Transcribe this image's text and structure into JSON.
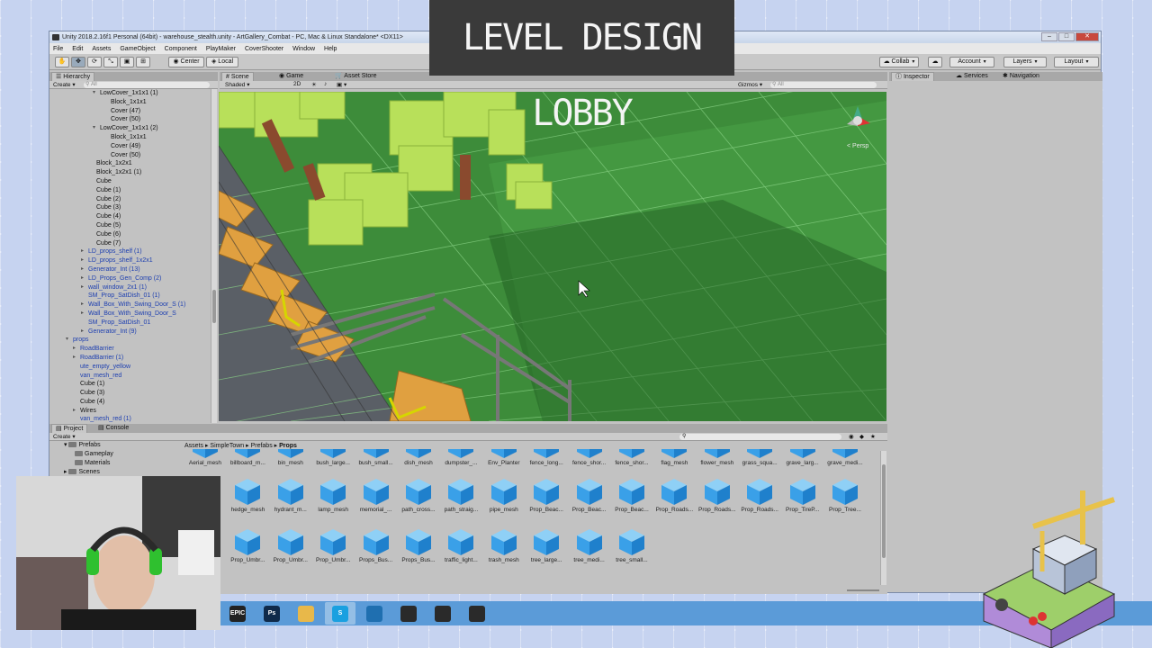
{
  "window": {
    "title": "Unity 2018.2.16f1 Personal (64bit) - warehouse_stealth.unity - ArtGallery_Combat - PC, Mac & Linux Standalone* <DX11>",
    "controls": {
      "minimize": "–",
      "maximize": "□",
      "close": "✕"
    }
  },
  "menu": [
    "File",
    "Edit",
    "Assets",
    "GameObject",
    "Component",
    "PlayMaker",
    "CoverShooter",
    "Window",
    "Help"
  ],
  "toolbar": {
    "pivot_center": "Center",
    "pivot_local": "Local",
    "collab": "Collab",
    "account": "Account",
    "layers": "Layers",
    "layout": "Layout"
  },
  "banner": {
    "text": "LEVEL DESIGN LOBBY"
  },
  "hierarchy": {
    "tab": "Hierarchy",
    "create": "Create",
    "search_placeholder": "All",
    "items": [
      {
        "label": "LowCover_1x1x1 (1)",
        "indent": 56,
        "prefab": false,
        "arrow": "▾"
      },
      {
        "label": "Block_1x1x1",
        "indent": 68,
        "prefab": false,
        "arrow": ""
      },
      {
        "label": "Cover (47)",
        "indent": 68,
        "prefab": false,
        "arrow": ""
      },
      {
        "label": "Cover (50)",
        "indent": 68,
        "prefab": false,
        "arrow": ""
      },
      {
        "label": "LowCover_1x1x1 (2)",
        "indent": 56,
        "prefab": false,
        "arrow": "▾"
      },
      {
        "label": "Block_1x1x1",
        "indent": 68,
        "prefab": false,
        "arrow": ""
      },
      {
        "label": "Cover (49)",
        "indent": 68,
        "prefab": false,
        "arrow": ""
      },
      {
        "label": "Cover (50)",
        "indent": 68,
        "prefab": false,
        "arrow": ""
      },
      {
        "label": "Block_1x2x1",
        "indent": 52,
        "prefab": false,
        "arrow": ""
      },
      {
        "label": "Block_1x2x1 (1)",
        "indent": 52,
        "prefab": false,
        "arrow": ""
      },
      {
        "label": "Cube",
        "indent": 52,
        "prefab": false,
        "arrow": ""
      },
      {
        "label": "Cube (1)",
        "indent": 52,
        "prefab": false,
        "arrow": ""
      },
      {
        "label": "Cube (2)",
        "indent": 52,
        "prefab": false,
        "arrow": ""
      },
      {
        "label": "Cube (3)",
        "indent": 52,
        "prefab": false,
        "arrow": ""
      },
      {
        "label": "Cube (4)",
        "indent": 52,
        "prefab": false,
        "arrow": ""
      },
      {
        "label": "Cube (5)",
        "indent": 52,
        "prefab": false,
        "arrow": ""
      },
      {
        "label": "Cube (6)",
        "indent": 52,
        "prefab": false,
        "arrow": ""
      },
      {
        "label": "Cube (7)",
        "indent": 52,
        "prefab": false,
        "arrow": ""
      },
      {
        "label": "LD_props_shelf (1)",
        "indent": 43,
        "prefab": true,
        "arrow": "▸"
      },
      {
        "label": "LD_props_shelf_1x2x1",
        "indent": 43,
        "prefab": true,
        "arrow": "▸"
      },
      {
        "label": "Generator_Int (13)",
        "indent": 43,
        "prefab": true,
        "arrow": "▸"
      },
      {
        "label": "LD_Props_Gen_Comp (2)",
        "indent": 43,
        "prefab": true,
        "arrow": "▸"
      },
      {
        "label": "wall_window_2x1 (1)",
        "indent": 43,
        "prefab": true,
        "arrow": "▸"
      },
      {
        "label": "SM_Prop_SatDish_01 (1)",
        "indent": 43,
        "prefab": true,
        "arrow": ""
      },
      {
        "label": "Wall_Box_With_Swing_Door_S (1)",
        "indent": 43,
        "prefab": true,
        "arrow": "▸"
      },
      {
        "label": "Wall_Box_With_Swing_Door_S",
        "indent": 43,
        "prefab": true,
        "arrow": "▸"
      },
      {
        "label": "SM_Prop_SatDish_01",
        "indent": 43,
        "prefab": true,
        "arrow": ""
      },
      {
        "label": "Generator_Int (9)",
        "indent": 43,
        "prefab": true,
        "arrow": "▸"
      },
      {
        "label": "props",
        "indent": 26,
        "prefab": true,
        "arrow": "▾"
      },
      {
        "label": "RoadBarrier",
        "indent": 34,
        "prefab": true,
        "arrow": "▸"
      },
      {
        "label": "RoadBarrier (1)",
        "indent": 34,
        "prefab": true,
        "arrow": "▸"
      },
      {
        "label": "ute_empty_yellow",
        "indent": 34,
        "prefab": true,
        "arrow": ""
      },
      {
        "label": "van_mesh_red",
        "indent": 34,
        "prefab": true,
        "arrow": ""
      },
      {
        "label": "Cube (1)",
        "indent": 34,
        "prefab": false,
        "arrow": ""
      },
      {
        "label": "Cube (3)",
        "indent": 34,
        "prefab": false,
        "arrow": ""
      },
      {
        "label": "Cube (4)",
        "indent": 34,
        "prefab": false,
        "arrow": ""
      },
      {
        "label": "Wires",
        "indent": 34,
        "prefab": false,
        "arrow": "▸"
      },
      {
        "label": "van_mesh_red (1)",
        "indent": 34,
        "prefab": true,
        "arrow": ""
      }
    ]
  },
  "scene": {
    "tabs": [
      "Scene",
      "Game",
      "Asset Store"
    ],
    "shading": "Shaded",
    "mode_2d": "2D",
    "gizmos": "Gizmos",
    "search_placeholder": "All",
    "persp_label": "< Persp"
  },
  "inspector": {
    "tabs": [
      "Inspector",
      "Services",
      "Navigation"
    ]
  },
  "project": {
    "tabs": [
      "Project",
      "Console"
    ],
    "create": "Create",
    "folders": [
      "Prefabs",
      "Gameplay",
      "Materials",
      "Scenes"
    ],
    "breadcrumb": [
      "Assets",
      "SimpleTown",
      "Prefabs",
      "Props"
    ],
    "asset_rows": [
      [
        "Aerial_mesh",
        "billboard_m...",
        "bin_mesh",
        "bush_large...",
        "bush_small...",
        "dish_mesh",
        "dumpster_...",
        "Env_Planter",
        "fence_long...",
        "fence_shor...",
        "fence_shor...",
        "flag_mesh",
        "flower_mesh",
        "grass_squa...",
        "grave_larg...",
        "grave_medi..."
      ],
      [
        "",
        "hedge_mesh",
        "hydrant_m...",
        "lamp_mesh",
        "memorial_...",
        "path_cross...",
        "path_straig...",
        "pipe_mesh",
        "Prop_Beac...",
        "Prop_Beac...",
        "Prop_Beac...",
        "Prop_Roads...",
        "Prop_Roads...",
        "Prop_Roads...",
        "Prop_TireP...",
        "Prop_Tree..."
      ],
      [
        "",
        "Prop_Umbr...",
        "Prop_Umbr...",
        "Prop_Umbr...",
        "Props_Bus...",
        "Props_Bus...",
        "traffic_light...",
        "trash_mesh",
        "tree_large...",
        "tree_medi...",
        "tree_small..."
      ]
    ]
  },
  "taskbar": {
    "apps": [
      {
        "name": "epic-games-icon",
        "text": "EPIC",
        "color": "#222222"
      },
      {
        "name": "photoshop-icon",
        "text": "Ps",
        "color": "#0f2a4a"
      },
      {
        "name": "explorer-icon",
        "text": "",
        "color": "#e8b84a"
      },
      {
        "name": "skype-icon",
        "text": "S",
        "color": "#1aa0e0"
      },
      {
        "name": "blender-icon",
        "text": "",
        "color": "#1f6fb0"
      },
      {
        "name": "unity-icon",
        "text": "",
        "color": "#2a2a2a"
      },
      {
        "name": "obs-icon",
        "text": "",
        "color": "#2a2a2a"
      },
      {
        "name": "search-app-icon",
        "text": "",
        "color": "#2a2a2a"
      }
    ]
  },
  "colors": {
    "grass": "#3d8c3a",
    "grid": "#7ec87a",
    "tree": "#b8e05a",
    "trunk": "#8a4a2e",
    "wood": "#e0a040",
    "taskbar": "#5b9bd8",
    "prefab_text": "#1d3fb0"
  }
}
